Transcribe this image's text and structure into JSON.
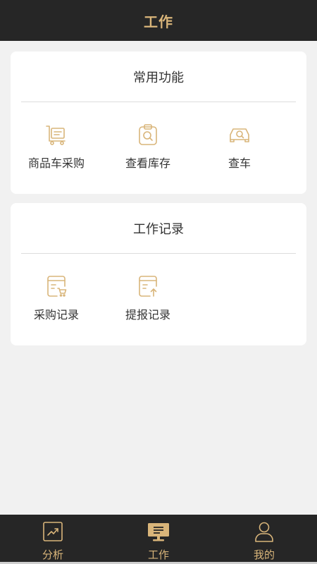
{
  "header": {
    "title": "工作"
  },
  "colors": {
    "accent": "#d9b57a",
    "dark": "#262626",
    "background": "#f1f1f1"
  },
  "common_functions": {
    "title": "常用功能",
    "items": [
      {
        "label": "商品车采购",
        "icon": "cart-icon"
      },
      {
        "label": "查看库存",
        "icon": "clipboard-search-icon"
      },
      {
        "label": "查车",
        "icon": "car-search-icon"
      }
    ]
  },
  "work_records": {
    "title": "工作记录",
    "items": [
      {
        "label": "采购记录",
        "icon": "purchase-record-icon"
      },
      {
        "label": "提报记录",
        "icon": "report-record-icon"
      }
    ]
  },
  "tabbar": {
    "tabs": [
      {
        "label": "分析",
        "icon": "chart-icon"
      },
      {
        "label": "工作",
        "icon": "monitor-icon"
      },
      {
        "label": "我的",
        "icon": "user-icon"
      }
    ]
  }
}
